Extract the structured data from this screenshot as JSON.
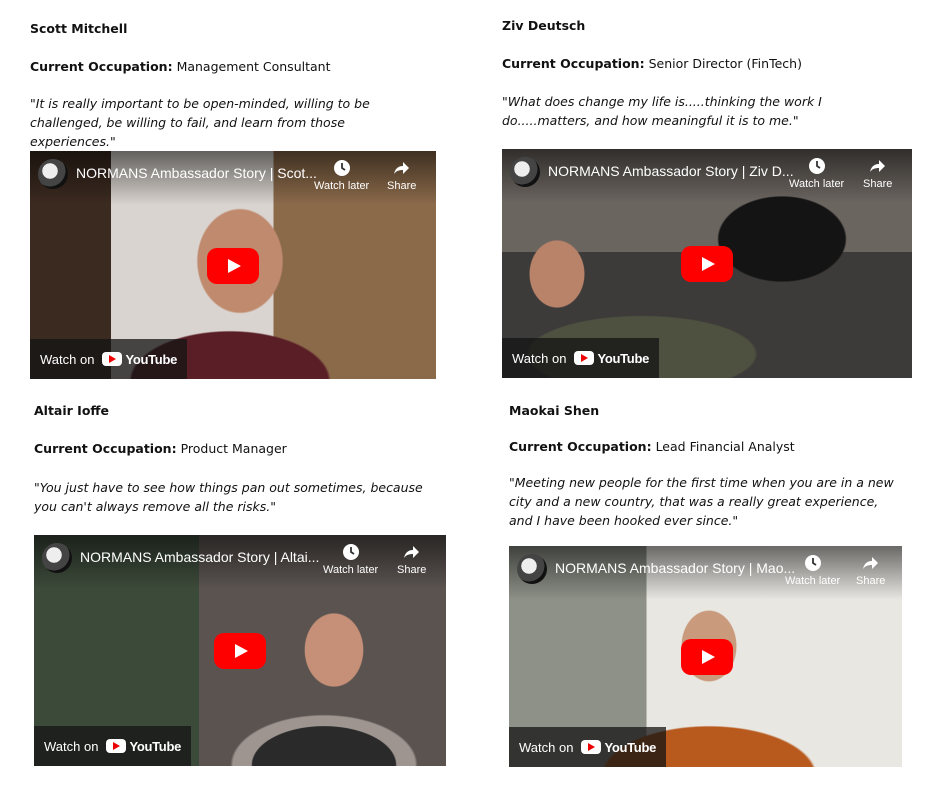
{
  "cards": [
    {
      "name": "Scott Mitchell",
      "occupation_label": "Current Occupation:",
      "occupation": "Management Consultant",
      "quote": "\"It is really important to be open-minded, willing to be challenged, be willing to fail, and learn from those experiences.\"",
      "video": {
        "title": "NORMANS Ambassador Story | Scot...",
        "watch_later": "Watch later",
        "share": "Share",
        "watch_on": "Watch on",
        "youtube": "YouTube"
      }
    },
    {
      "name": "Ziv Deutsch",
      "occupation_label": "Current Occupation:",
      "occupation": "Senior Director (FinTech)",
      "quote": "\"What does change my life is.....thinking the work I do.....matters, and how meaningful it is to me.\"",
      "video": {
        "title": "NORMANS Ambassador Story | Ziv D...",
        "watch_later": "Watch later",
        "share": "Share",
        "watch_on": "Watch on",
        "youtube": "YouTube"
      }
    },
    {
      "name": "Altair Ioffe",
      "occupation_label": "Current Occupation:",
      "occupation": "Product Manager",
      "quote": " \"You just have to see how things pan out sometimes, because you can't always remove all the risks.\"",
      "video": {
        "title": "NORMANS Ambassador Story | Altai...",
        "watch_later": "Watch later",
        "share": "Share",
        "watch_on": "Watch on",
        "youtube": "YouTube"
      }
    },
    {
      "name": "Maokai Shen",
      "occupation_label": "Current Occupation:",
      "occupation": "Lead Financial Analyst",
      "quote": "\"Meeting new people for the first time when you are in a new city and a new country, that was a really great experience, and I have been hooked ever since.\"",
      "video": {
        "title": "NORMANS Ambassador Story | Mao...",
        "watch_later": "Watch later",
        "share": "Share",
        "watch_on": "Watch on",
        "youtube": "YouTube"
      }
    }
  ],
  "icons": {
    "clock": "clock-icon",
    "share": "share-arrow-icon",
    "play": "play-icon",
    "youtube": "youtube-logo-icon"
  },
  "colors": {
    "play_button": "#ff0000",
    "text": "#111111"
  }
}
